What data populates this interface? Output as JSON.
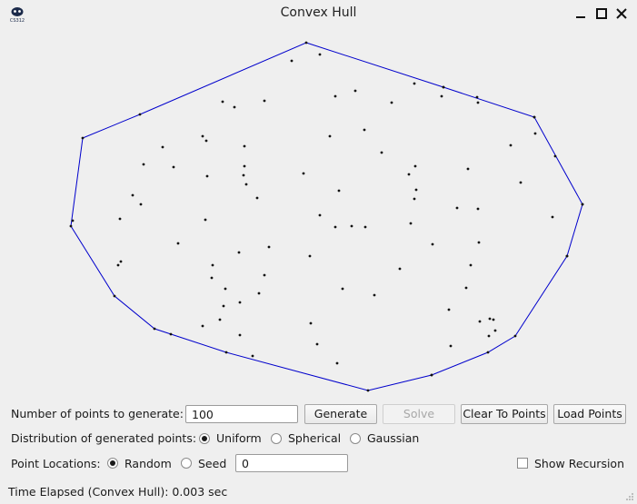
{
  "window": {
    "title": "Convex Hull",
    "app_icon": "byu-cs312-logo",
    "app_icon_text": "CS312",
    "controls": [
      "minimize-icon",
      "maximize-icon",
      "close-icon"
    ]
  },
  "canvas": {
    "hull_color": "#0000cc",
    "point_color": "#111111"
  },
  "controls": {
    "points_label": "Number of points to generate:",
    "points_value": "100",
    "generate_label": "Generate",
    "solve_label": "Solve",
    "clear_label": "Clear To Points",
    "load_label": "Load Points",
    "distribution_label": "Distribution of generated points:",
    "distribution_options": [
      "Uniform",
      "Spherical",
      "Gaussian"
    ],
    "distribution_selected": "Uniform",
    "locations_label": "Point Locations:",
    "location_options": [
      "Random",
      "Seed"
    ],
    "location_selected": "Random",
    "seed_value": "0",
    "show_recursion_label": "Show Recursion",
    "show_recursion_checked": false
  },
  "status": {
    "time_elapsed": "Time Elapsed (Convex Hull): 0.003 sec"
  }
}
